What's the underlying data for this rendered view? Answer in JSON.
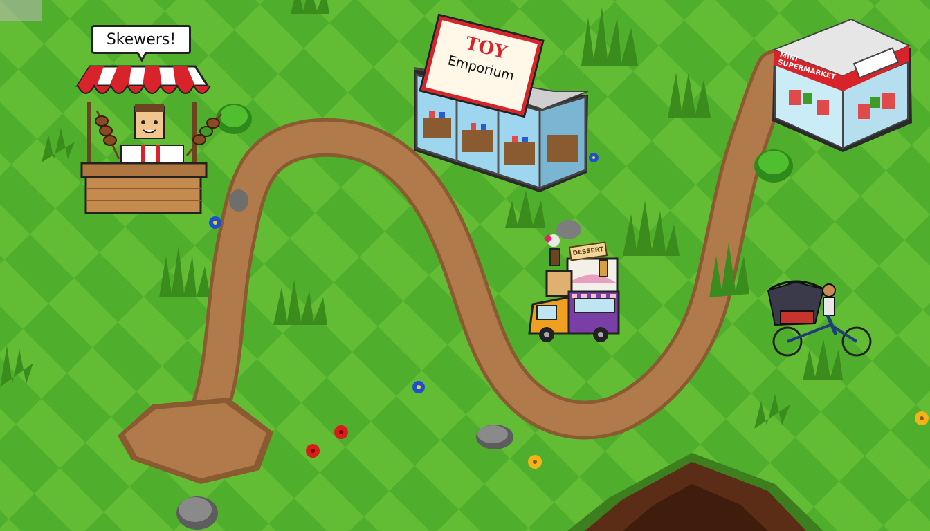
{
  "scene": {
    "type": "pixel-art game world",
    "colors": {
      "grass_light": "#6cc43a",
      "grass_dark": "#4fae2c",
      "path": "#b07a4a",
      "path_edge": "#8a5a31",
      "pit": "#5b2d17"
    }
  },
  "skewer_stand": {
    "speech_text": "Skewers!",
    "awning_colors": [
      "#d8232a",
      "#ffffff"
    ]
  },
  "toy_store": {
    "sign_line1": "TOY",
    "sign_line2": "Emporium"
  },
  "supermarket": {
    "sign_text": "MINI SUPERMARKET"
  },
  "food_truck": {
    "sign_text": "DESSERT"
  },
  "rickshaw": {
    "icon": "bicycle-rickshaw-icon"
  },
  "decorations": {
    "flowers": [
      "blue",
      "blue",
      "red",
      "red",
      "yellow",
      "yellow"
    ],
    "rocks": 4
  }
}
